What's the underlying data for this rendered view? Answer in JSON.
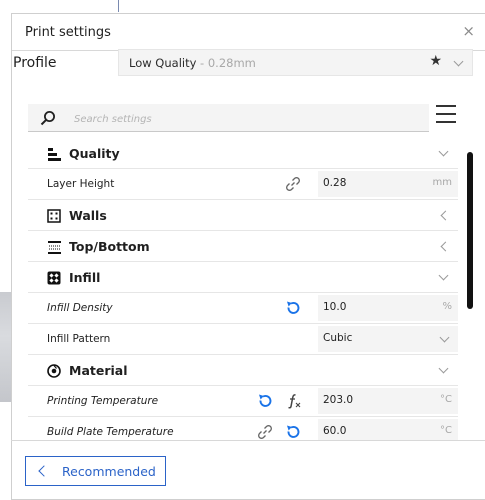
{
  "header": {
    "title": "Print settings",
    "close_symbol": "×"
  },
  "profile": {
    "label": "Profile",
    "name": "Low Quality",
    "sub": " - 0.28mm",
    "star": "★"
  },
  "search": {
    "placeholder": "Search settings"
  },
  "categories": {
    "quality": "Quality",
    "walls": "Walls",
    "top_bottom": "Top/Bottom",
    "infill": "Infill",
    "material": "Material"
  },
  "settings": {
    "layer_height": {
      "label": "Layer Height",
      "value": "0.28",
      "unit": "mm"
    },
    "infill_density": {
      "label": "Infill Density",
      "value": "10.0",
      "unit": "%"
    },
    "infill_pattern": {
      "label": "Infill Pattern",
      "value": "Cubic"
    },
    "printing_temperature": {
      "label": "Printing Temperature",
      "value": "203.0",
      "unit": "°C"
    },
    "build_plate_temperature": {
      "label": "Build Plate Temperature",
      "value": "60.0",
      "unit": "°C"
    }
  },
  "footer": {
    "recommended_label": "Recommended"
  },
  "colors": {
    "accent": "#2b63c8",
    "reset_icon": "#1a73e8"
  }
}
